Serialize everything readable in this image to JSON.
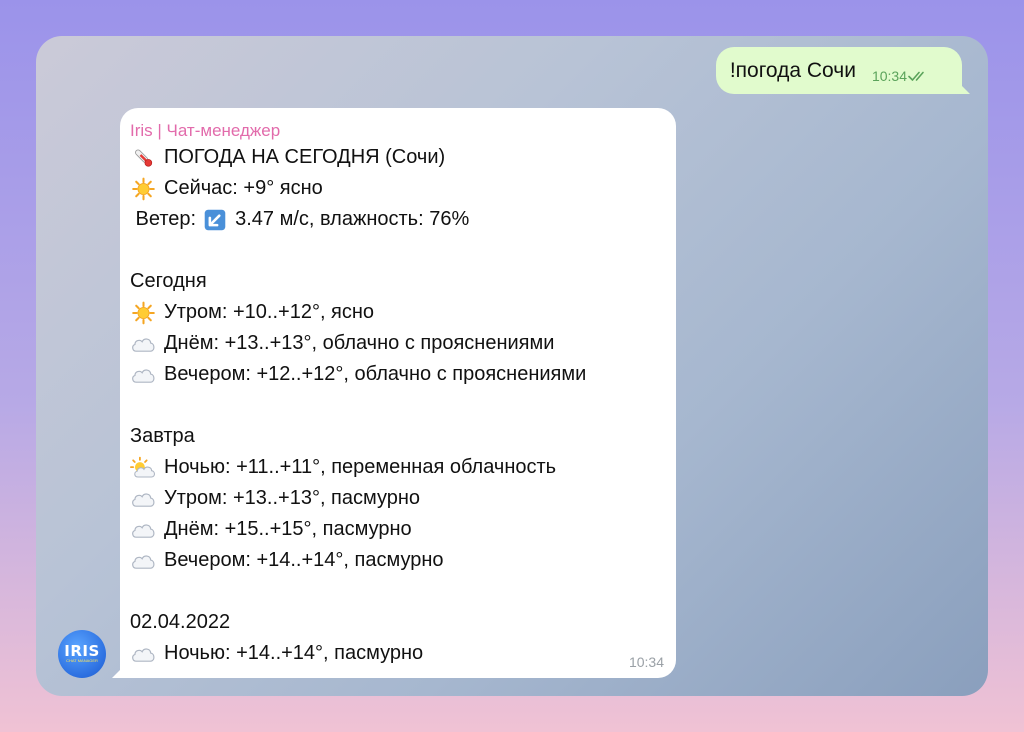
{
  "outgoing": {
    "text": "!погода Сочи",
    "time": "10:34",
    "status_icon": "double-check-icon",
    "status_color": "#5aa35a"
  },
  "incoming": {
    "sender": "Iris | Чат-менеджер",
    "sender_color": "#e26bab",
    "time": "10:34",
    "lines": {
      "header": "ПОГОДА НА СЕГОДНЯ (Сочи)",
      "now": "Сейчас: +9° ясно",
      "wind_label": " Ветер:",
      "wind_value": "3.47 м/с, влажность: 76%",
      "today": "Сегодня",
      "today_morning": "Утром: +10..+12°, ясно",
      "today_day": "Днём: +13..+13°, облачно с прояснениями",
      "today_evening": "Вечером: +12..+12°, облачно с прояснениями",
      "tomorrow": "Завтра",
      "tomorrow_night": "Ночью: +11..+11°, переменная облачность",
      "tomorrow_morning": "Утром: +13..+13°, пасмурно",
      "tomorrow_day": "Днём: +15..+15°, пасмурно",
      "tomorrow_evening": "Вечером: +14..+14°, пасмурно",
      "date": "02.04.2022",
      "date_night": "Ночью: +14..+14°, пасмурно"
    }
  },
  "avatar": {
    "logo": "IRIS",
    "subtitle": "CHAT MANAGER"
  }
}
